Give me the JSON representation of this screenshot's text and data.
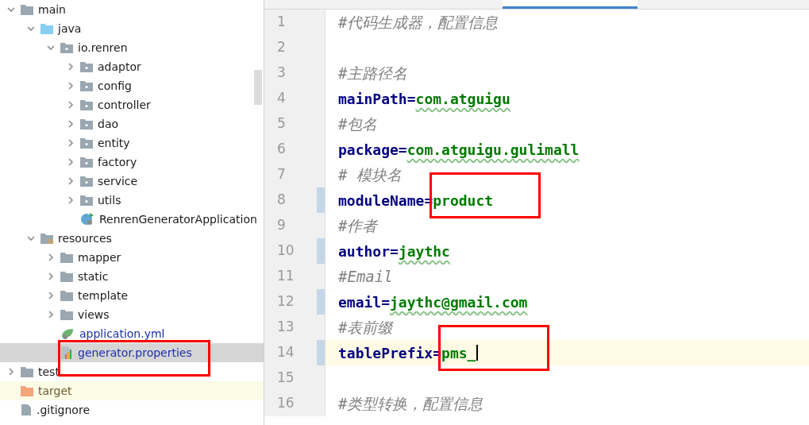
{
  "project_tree": [
    {
      "label": "main",
      "kind": "folder",
      "expanded": true,
      "selected": false,
      "children": [
        {
          "label": "java",
          "kind": "source",
          "expanded": true,
          "selected": false,
          "children": [
            {
              "label": "io.renren",
              "kind": "package",
              "expanded": true,
              "selected": false,
              "children": [
                {
                  "label": "adaptor",
                  "kind": "package",
                  "expanded": false,
                  "selected": false
                },
                {
                  "label": "config",
                  "kind": "package",
                  "expanded": false,
                  "selected": false
                },
                {
                  "label": "controller",
                  "kind": "package",
                  "expanded": false,
                  "selected": false
                },
                {
                  "label": "dao",
                  "kind": "package",
                  "expanded": false,
                  "selected": false
                },
                {
                  "label": "entity",
                  "kind": "package",
                  "expanded": false,
                  "selected": false
                },
                {
                  "label": "factory",
                  "kind": "package",
                  "expanded": false,
                  "selected": false
                },
                {
                  "label": "service",
                  "kind": "package",
                  "expanded": false,
                  "selected": false
                },
                {
                  "label": "utils",
                  "kind": "package",
                  "expanded": false,
                  "selected": false
                },
                {
                  "label": "RenrenGeneratorApplication",
                  "kind": "class",
                  "selected": false
                }
              ]
            }
          ]
        },
        {
          "label": "resources",
          "kind": "resources",
          "expanded": true,
          "selected": false,
          "children": [
            {
              "label": "mapper",
              "kind": "folder",
              "expanded": false,
              "selected": false
            },
            {
              "label": "static",
              "kind": "folder",
              "expanded": false,
              "selected": false
            },
            {
              "label": "template",
              "kind": "folder",
              "expanded": false,
              "selected": false
            },
            {
              "label": "views",
              "kind": "folder",
              "expanded": false,
              "selected": false
            },
            {
              "label": "application.yml",
              "kind": "yml",
              "selected": false
            },
            {
              "label": "generator.properties",
              "kind": "properties",
              "selected": true,
              "highlighted": true
            }
          ]
        }
      ]
    },
    {
      "label": "test",
      "kind": "folder",
      "expanded": false,
      "selected": false
    },
    {
      "label": "target",
      "kind": "excluded",
      "selected": false
    },
    {
      "label": ".gitignore",
      "kind": "file",
      "selected": false
    }
  ],
  "editor": {
    "lines": [
      {
        "number": "1",
        "kind": "comment",
        "text": "#代码生成器，配置信息",
        "changed": false,
        "current": false
      },
      {
        "number": "2",
        "kind": "blank",
        "changed": false,
        "current": false
      },
      {
        "number": "3",
        "kind": "comment",
        "text": "#主路径名",
        "changed": false,
        "current": false
      },
      {
        "number": "4",
        "kind": "property",
        "key": "mainPath",
        "separator": "=",
        "value": "com.atguigu",
        "typo": true,
        "changed": false,
        "current": false
      },
      {
        "number": "5",
        "kind": "comment",
        "text": "#包名",
        "changed": false,
        "current": false
      },
      {
        "number": "6",
        "kind": "property",
        "key": "package",
        "separator": "=",
        "value": "com.atguigu.gulimall",
        "typo": true,
        "changed": false,
        "current": false
      },
      {
        "number": "7",
        "kind": "comment",
        "text": "# 模块名",
        "changed": false,
        "current": false
      },
      {
        "number": "8",
        "kind": "property",
        "key": "moduleName",
        "separator": "=",
        "value": "product",
        "typo": false,
        "highlighted": true,
        "changed": true,
        "current": false
      },
      {
        "number": "9",
        "kind": "comment",
        "text": "#作者",
        "changed": false,
        "current": false
      },
      {
        "number": "10",
        "kind": "property",
        "key": "author",
        "separator": "=",
        "value": "jaythc",
        "typo": true,
        "changed": true,
        "current": false
      },
      {
        "number": "11",
        "kind": "comment",
        "text": "#Email",
        "changed": false,
        "current": false
      },
      {
        "number": "12",
        "kind": "property",
        "key": "email",
        "separator": "=",
        "value": "jaythc@gmail.com",
        "typo": true,
        "changed": true,
        "current": false
      },
      {
        "number": "13",
        "kind": "comment",
        "text": "#表前缀",
        "changed": false,
        "current": false
      },
      {
        "number": "14",
        "kind": "property",
        "key": "tablePrefix",
        "separator": "=",
        "value": "pms_",
        "typo": false,
        "highlighted": true,
        "changed": true,
        "current": true
      },
      {
        "number": "15",
        "kind": "blank",
        "changed": false,
        "current": false
      },
      {
        "number": "16",
        "kind": "comment",
        "text": "#类型转换，配置信息",
        "changed": false,
        "current": false
      }
    ]
  }
}
